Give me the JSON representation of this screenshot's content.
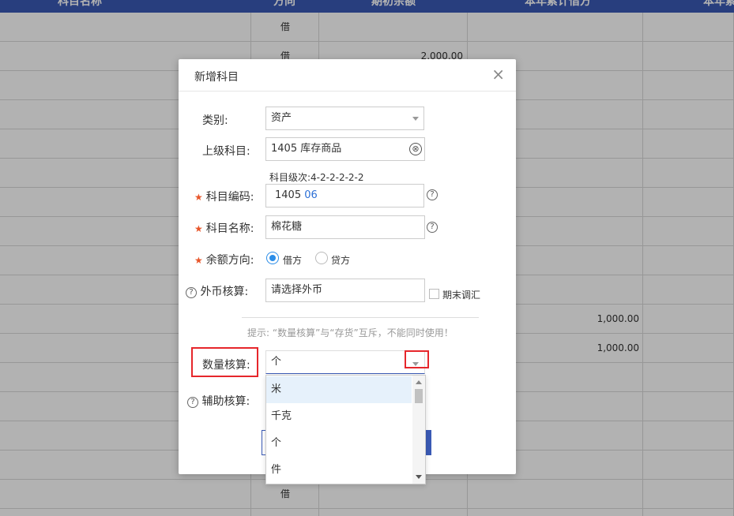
{
  "table": {
    "headers": [
      "科目名称",
      "方向",
      "期初余额",
      "本年累计借方",
      "本年累"
    ],
    "rows": [
      {
        "direction": "借",
        "opening": "",
        "debit": ""
      },
      {
        "direction": "借",
        "opening": "2,000.00",
        "debit": ""
      },
      {
        "direction": "",
        "opening": "",
        "debit": ""
      },
      {
        "direction": "",
        "opening": "",
        "debit": ""
      },
      {
        "direction": "",
        "opening": "",
        "debit": ""
      },
      {
        "direction": "",
        "opening": "",
        "debit": ""
      },
      {
        "direction": "",
        "opening": "",
        "debit": ""
      },
      {
        "direction": "",
        "opening": "",
        "debit": ""
      },
      {
        "direction": "",
        "opening": "",
        "debit": ""
      },
      {
        "direction": "",
        "opening": "",
        "debit": ""
      },
      {
        "direction": "",
        "opening": "",
        "debit": "1,000.00"
      },
      {
        "direction": "",
        "opening": "",
        "debit": "1,000.00"
      },
      {
        "direction": "",
        "opening": "",
        "debit": ""
      },
      {
        "direction": "",
        "opening": "",
        "debit": ""
      },
      {
        "direction": "",
        "opening": "",
        "debit": ""
      },
      {
        "direction": "",
        "opening": "",
        "debit": ""
      },
      {
        "direction": "借",
        "opening": "",
        "debit": ""
      },
      {
        "direction": "借",
        "opening": "",
        "debit": ""
      }
    ]
  },
  "modal": {
    "title": "新增科目",
    "close_glyph": "×",
    "category": {
      "label": "类别:",
      "value": "资产"
    },
    "parent": {
      "label": "上级科目:",
      "value": "1405 库存商品",
      "clear_glyph": "⊗"
    },
    "level": {
      "prefix": "科目级次:",
      "value": "4-2-2-2-2-2"
    },
    "code": {
      "label": "科目编码:",
      "prefix": "1405",
      "suffix": "06"
    },
    "name": {
      "label": "科目名称:",
      "value": "棉花糖"
    },
    "balance": {
      "label": "余额方向:",
      "options": [
        "借方",
        "贷方"
      ],
      "selected": "借方"
    },
    "currency": {
      "label": "外币核算:",
      "placeholder": "请选择外币",
      "checkbox_label": "期末调汇"
    },
    "hint": "提示: “数量核算”与“存货”互斥，不能同时使用！",
    "quantity": {
      "label": "数量核算:",
      "value": "个",
      "options": [
        "米",
        "千克",
        "个",
        "件"
      ],
      "highlighted": "米"
    },
    "aux": {
      "label": "辅助核算:"
    },
    "star_glyph": "★",
    "help_glyph": "?"
  },
  "colors": {
    "header": "#3a5ab5",
    "accent": "#2b8de8",
    "required": "#e8562a",
    "annotation": "#e6262b"
  }
}
